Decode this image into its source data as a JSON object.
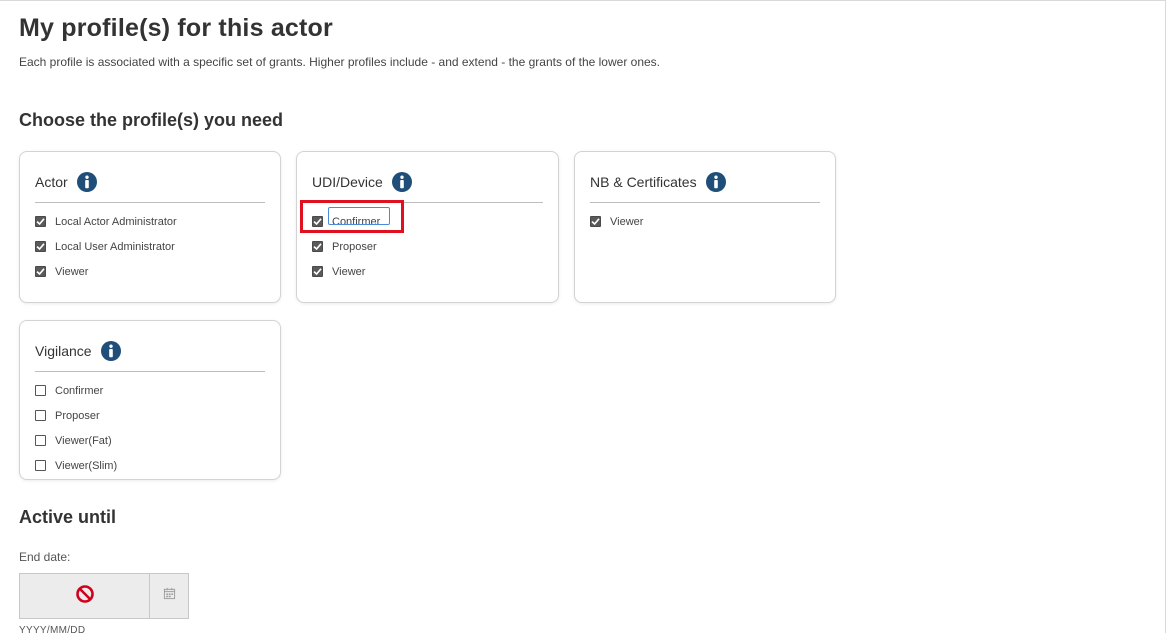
{
  "page": {
    "title": "My profile(s) for this actor",
    "intro": "Each profile is associated with a specific set of grants. Higher profiles include - and extend - the grants of the lower ones."
  },
  "profiles": {
    "heading": "Choose the profile(s) you need",
    "groups": [
      {
        "title": "Actor",
        "items": [
          {
            "label": "Local Actor Administrator",
            "checked": true
          },
          {
            "label": "Local User Administrator",
            "checked": true
          },
          {
            "label": "Viewer",
            "checked": true
          }
        ]
      },
      {
        "title": "UDI/Device",
        "items": [
          {
            "label": "Confirmer",
            "checked": true
          },
          {
            "label": "Proposer",
            "checked": true
          },
          {
            "label": "Viewer",
            "checked": true
          }
        ]
      },
      {
        "title": "NB & Certificates",
        "items": [
          {
            "label": "Viewer",
            "checked": true
          }
        ]
      },
      {
        "title": "Vigilance",
        "items": [
          {
            "label": "Confirmer",
            "checked": false
          },
          {
            "label": "Proposer",
            "checked": false
          },
          {
            "label": "Viewer(Fat)",
            "checked": false
          },
          {
            "label": "Viewer(Slim)",
            "checked": false
          }
        ]
      }
    ]
  },
  "active_until": {
    "heading": "Active until",
    "end_date_label": "End date:",
    "date_value": "",
    "date_format_hint": "YYYY/MM/DD",
    "input_icon": "prohibited-icon",
    "button_icon": "calendar-icon"
  },
  "colors": {
    "info_icon": "#1f4e79",
    "highlight": "#e0101e",
    "prohibited": "#d0021b",
    "checked_box": "#5a5a5a"
  }
}
